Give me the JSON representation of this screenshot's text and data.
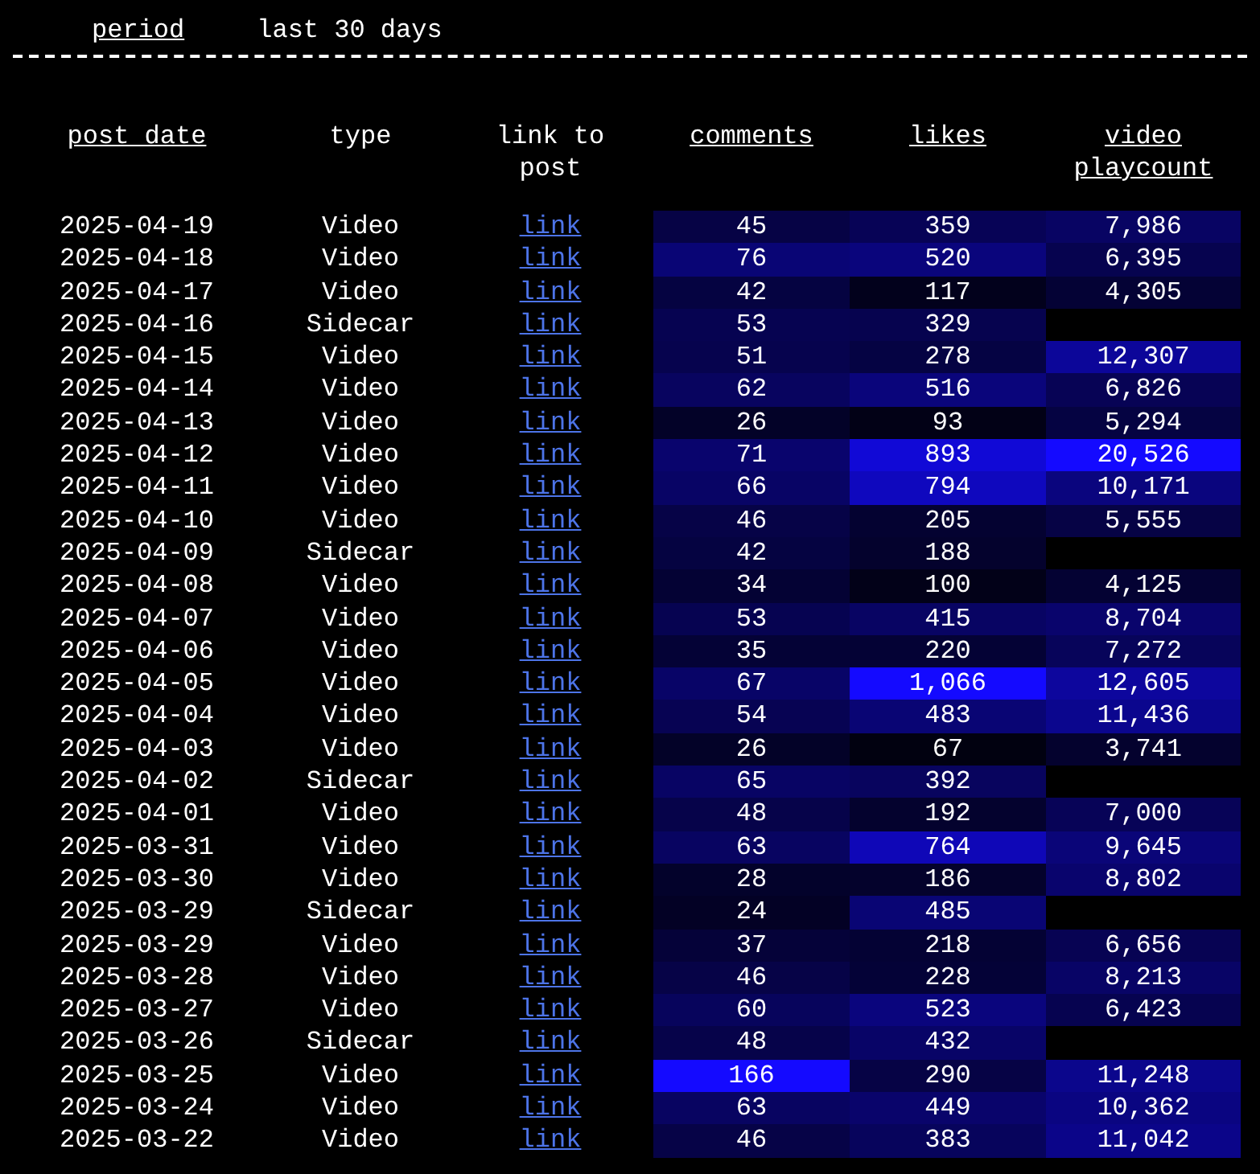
{
  "filter": {
    "label": "period",
    "value": "last 30 days"
  },
  "columns": [
    {
      "label": "post date",
      "sortable": true
    },
    {
      "label": "type",
      "sortable": false
    },
    {
      "label": "link to post",
      "sortable": false
    },
    {
      "label": "comments",
      "sortable": true
    },
    {
      "label": "likes",
      "sortable": true
    },
    {
      "label": "video playcount",
      "sortable": true
    }
  ],
  "rows": [
    {
      "post_date": "2025-04-19",
      "type": "Video",
      "link": "link",
      "comments": "45",
      "likes": "359",
      "video_playcount": "7,986"
    },
    {
      "post_date": "2025-04-18",
      "type": "Video",
      "link": "link",
      "comments": "76",
      "likes": "520",
      "video_playcount": "6,395"
    },
    {
      "post_date": "2025-04-17",
      "type": "Video",
      "link": "link",
      "comments": "42",
      "likes": "117",
      "video_playcount": "4,305"
    },
    {
      "post_date": "2025-04-16",
      "type": "Sidecar",
      "link": "link",
      "comments": "53",
      "likes": "329"
    },
    {
      "post_date": "2025-04-15",
      "type": "Video",
      "link": "link",
      "comments": "51",
      "likes": "278",
      "video_playcount": "12,307"
    },
    {
      "post_date": "2025-04-14",
      "type": "Video",
      "link": "link",
      "comments": "62",
      "likes": "516",
      "video_playcount": "6,826"
    },
    {
      "post_date": "2025-04-13",
      "type": "Video",
      "link": "link",
      "comments": "26",
      "likes": "93",
      "video_playcount": "5,294"
    },
    {
      "post_date": "2025-04-12",
      "type": "Video",
      "link": "link",
      "comments": "71",
      "likes": "893",
      "video_playcount": "20,526"
    },
    {
      "post_date": "2025-04-11",
      "type": "Video",
      "link": "link",
      "comments": "66",
      "likes": "794",
      "video_playcount": "10,171"
    },
    {
      "post_date": "2025-04-10",
      "type": "Video",
      "link": "link",
      "comments": "46",
      "likes": "205",
      "video_playcount": "5,555"
    },
    {
      "post_date": "2025-04-09",
      "type": "Sidecar",
      "link": "link",
      "comments": "42",
      "likes": "188"
    },
    {
      "post_date": "2025-04-08",
      "type": "Video",
      "link": "link",
      "comments": "34",
      "likes": "100",
      "video_playcount": "4,125"
    },
    {
      "post_date": "2025-04-07",
      "type": "Video",
      "link": "link",
      "comments": "53",
      "likes": "415",
      "video_playcount": "8,704"
    },
    {
      "post_date": "2025-04-06",
      "type": "Video",
      "link": "link",
      "comments": "35",
      "likes": "220",
      "video_playcount": "7,272"
    },
    {
      "post_date": "2025-04-05",
      "type": "Video",
      "link": "link",
      "comments": "67",
      "likes": "1,066",
      "video_playcount": "12,605"
    },
    {
      "post_date": "2025-04-04",
      "type": "Video",
      "link": "link",
      "comments": "54",
      "likes": "483",
      "video_playcount": "11,436"
    },
    {
      "post_date": "2025-04-03",
      "type": "Video",
      "link": "link",
      "comments": "26",
      "likes": "67",
      "video_playcount": "3,741"
    },
    {
      "post_date": "2025-04-02",
      "type": "Sidecar",
      "link": "link",
      "comments": "65",
      "likes": "392"
    },
    {
      "post_date": "2025-04-01",
      "type": "Video",
      "link": "link",
      "comments": "48",
      "likes": "192",
      "video_playcount": "7,000"
    },
    {
      "post_date": "2025-03-31",
      "type": "Video",
      "link": "link",
      "comments": "63",
      "likes": "764",
      "video_playcount": "9,645"
    },
    {
      "post_date": "2025-03-30",
      "type": "Video",
      "link": "link",
      "comments": "28",
      "likes": "186",
      "video_playcount": "8,802"
    },
    {
      "post_date": "2025-03-29",
      "type": "Sidecar",
      "link": "link",
      "comments": "24",
      "likes": "485"
    },
    {
      "post_date": "2025-03-29",
      "type": "Video",
      "link": "link",
      "comments": "37",
      "likes": "218",
      "video_playcount": "6,656"
    },
    {
      "post_date": "2025-03-28",
      "type": "Video",
      "link": "link",
      "comments": "46",
      "likes": "228",
      "video_playcount": "8,213"
    },
    {
      "post_date": "2025-03-27",
      "type": "Video",
      "link": "link",
      "comments": "60",
      "likes": "523",
      "video_playcount": "6,423"
    },
    {
      "post_date": "2025-03-26",
      "type": "Sidecar",
      "link": "link",
      "comments": "48",
      "likes": "432"
    },
    {
      "post_date": "2025-03-25",
      "type": "Video",
      "link": "link",
      "comments": "166",
      "likes": "290",
      "video_playcount": "11,248"
    },
    {
      "post_date": "2025-03-24",
      "type": "Video",
      "link": "link",
      "comments": "63",
      "likes": "449",
      "video_playcount": "10,362"
    },
    {
      "post_date": "2025-03-22",
      "type": "Video",
      "link": "link",
      "comments": "46",
      "likes": "383",
      "video_playcount": "11,042"
    }
  ]
}
